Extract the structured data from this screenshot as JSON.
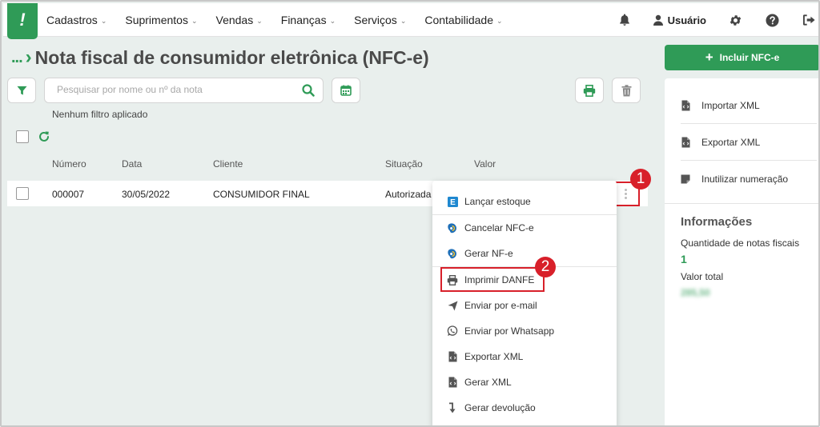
{
  "nav": {
    "logo": "!",
    "items": [
      {
        "label": "Cadastros"
      },
      {
        "label": "Suprimentos"
      },
      {
        "label": "Vendas"
      },
      {
        "label": "Finanças"
      },
      {
        "label": "Serviços"
      },
      {
        "label": "Contabilidade"
      }
    ],
    "user_label": "Usuário"
  },
  "page": {
    "breadcrumb_dots": "...",
    "title": "Nota fiscal de consumidor eletrônica (NFC-e)"
  },
  "filters": {
    "search_placeholder": "Pesquisar por nome ou nº da nota",
    "search_value": "",
    "status_text": "Nenhum filtro aplicado"
  },
  "table": {
    "headers": {
      "numero": "Número",
      "data": "Data",
      "cliente": "Cliente",
      "situacao": "Situação",
      "valor": "Valor"
    },
    "rows": [
      {
        "numero": "000007",
        "data": "30/05/2022",
        "cliente": "CONSUMIDOR FINAL",
        "situacao": "Autorizada",
        "valor": ""
      }
    ]
  },
  "menu": {
    "items": [
      {
        "label": "Lançar estoque",
        "icon": "estoque-e-icon"
      },
      {
        "label": "Cancelar NFC-e",
        "icon": "sefaz-icon"
      },
      {
        "label": "Gerar NF-e",
        "icon": "sefaz-icon"
      },
      {
        "label": "Imprimir DANFE",
        "icon": "printer-icon"
      },
      {
        "label": "Enviar por e-mail",
        "icon": "send-icon"
      },
      {
        "label": "Enviar por Whatsapp",
        "icon": "whatsapp-icon"
      },
      {
        "label": "Exportar XML",
        "icon": "xml-file-icon"
      },
      {
        "label": "Gerar XML",
        "icon": "xml-file-icon"
      },
      {
        "label": "Gerar devolução",
        "icon": "return-arrow-icon"
      }
    ]
  },
  "annotations": {
    "badge1": "1",
    "badge2": "2"
  },
  "sidebar": {
    "primary_button": "Incluir NFC-e",
    "items": [
      {
        "label": "Importar XML"
      },
      {
        "label": "Exportar XML"
      },
      {
        "label": "Inutilizar numeração"
      }
    ],
    "info_title": "Informações",
    "qty_label": "Quantidade de notas fiscais",
    "qty_value": "1",
    "total_label": "Valor total",
    "total_value": "285,50"
  },
  "colors": {
    "brand_green": "#2f9b57",
    "annotation_red": "#d8202a",
    "background": "#e9efed"
  }
}
